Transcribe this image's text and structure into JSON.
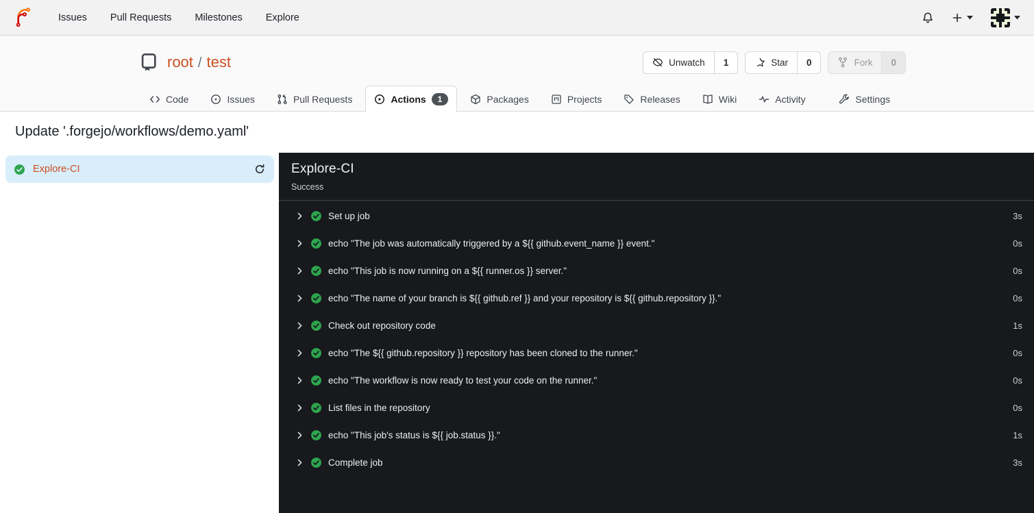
{
  "colors": {
    "accent": "#cc4e20",
    "navbar_bg": "#f2f2f3",
    "header_bg": "#fafafb",
    "border": "#d8dadc",
    "panel_bg": "#17191c",
    "panel_border": "#3f4650",
    "panel_text": "#e9ebed",
    "panel_muted": "#cfd3d6",
    "selected_bg": "#d8eefb",
    "badge_bg": "#4c5257",
    "success": "#2da44e",
    "text": "#1f2429",
    "disabled": "#97999c"
  },
  "topnav": {
    "items": [
      {
        "label": "Issues"
      },
      {
        "label": "Pull Requests"
      },
      {
        "label": "Milestones"
      },
      {
        "label": "Explore"
      }
    ]
  },
  "repo": {
    "owner": "root",
    "separator": "/",
    "name": "test",
    "actions": [
      {
        "label": "Unwatch",
        "count": "1"
      },
      {
        "label": "Star",
        "count": "0"
      },
      {
        "label": "Fork",
        "count": "0"
      }
    ]
  },
  "tabs": [
    {
      "label": "Code"
    },
    {
      "label": "Issues"
    },
    {
      "label": "Pull Requests"
    },
    {
      "label": "Actions",
      "badge": "1",
      "active": true
    },
    {
      "label": "Packages"
    },
    {
      "label": "Projects"
    },
    {
      "label": "Releases"
    },
    {
      "label": "Wiki"
    },
    {
      "label": "Activity"
    },
    {
      "label": "Settings"
    }
  ],
  "page": {
    "title": "Update '.forgejo/workflows/demo.yaml'"
  },
  "sidebar": {
    "jobs": [
      {
        "label": "Explore-CI",
        "status": "success"
      }
    ]
  },
  "run_panel": {
    "title": "Explore-CI",
    "status": "Success",
    "steps": [
      {
        "label": "Set up job",
        "duration": "3s"
      },
      {
        "label": "echo \"The job was automatically triggered by a ${{ github.event_name }} event.\"",
        "duration": "0s"
      },
      {
        "label": "echo \"This job is now running on a ${{ runner.os }} server.\"",
        "duration": "0s"
      },
      {
        "label": "echo \"The name of your branch is ${{ github.ref }} and your repository is ${{ github.repository }}.\"",
        "duration": "0s"
      },
      {
        "label": "Check out repository code",
        "duration": "1s"
      },
      {
        "label": "echo \"The ${{ github.repository }} repository has been cloned to the runner.\"",
        "duration": "0s"
      },
      {
        "label": "echo \"The workflow is now ready to test your code on the runner.\"",
        "duration": "0s"
      },
      {
        "label": "List files in the repository",
        "duration": "0s"
      },
      {
        "label": "echo \"This job's status is ${{ job.status }}.\"",
        "duration": "1s"
      },
      {
        "label": "Complete job",
        "duration": "3s"
      }
    ]
  }
}
